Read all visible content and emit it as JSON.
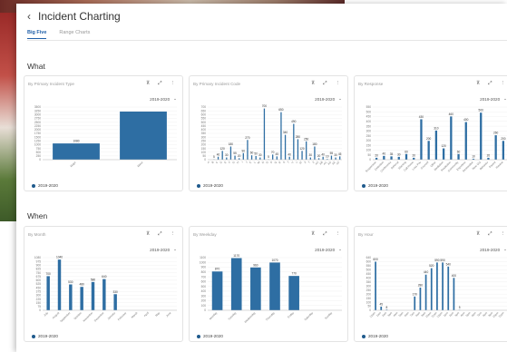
{
  "header": {
    "back_icon": "chevron-left-icon",
    "back_glyph": "‹",
    "title": "Incident Charting"
  },
  "tabs": [
    {
      "label": "Big Five",
      "active": true
    },
    {
      "label": "Range Charts",
      "active": false
    }
  ],
  "colors": {
    "bar": "#2e6ea3",
    "accent": "#1f5fa8"
  },
  "card_icons": {
    "pin": "pin-icon",
    "expand": "expand-icon",
    "menu": "more-vert-icon",
    "dropdown": "chevron-down-icon"
  },
  "sections": {
    "what": {
      "title": "What",
      "cards": [
        {
          "title": "By Primary Incident Type",
          "year": "2019-2020",
          "legend": "2019-2020",
          "chart_data": {
            "type": "bar",
            "categories": [
              "Major",
              "Minor"
            ],
            "values": [
              1080,
              3200
            ],
            "value_labels": [
              "1080",
              ""
            ],
            "yticks": [
              "3500",
              "3250",
              "3000",
              "2750",
              "2500",
              "2250",
              "2000",
              "1750",
              "1500",
              "1250",
              "1000",
              "750",
              "500",
              "250",
              "0"
            ],
            "ylim": [
              0,
              3500
            ]
          }
        },
        {
          "title": "By Primary Incident Code",
          "year": "2019-2020",
          "legend": "2019-2020",
          "chart_data": {
            "type": "bar",
            "categories": [
              "A",
              "B",
              "C",
              "D",
              "E",
              "F",
              "G",
              "H",
              "I",
              "J",
              "K",
              "L",
              "M",
              "N",
              "O",
              "P",
              "Q",
              "R",
              "S",
              "T",
              "U",
              "V",
              "W",
              "X",
              "Y",
              "Z",
              "AA",
              "AB",
              "AC",
              "AD",
              "AE",
              "AF"
            ],
            "values": [
              0,
              5,
              40,
              120,
              30,
              180,
              55,
              20,
              90,
              270,
              60,
              50,
              30,
              700,
              5,
              70,
              45,
              650,
              340,
              40,
              490,
              280,
              120,
              250,
              30,
              180,
              20,
              40,
              10,
              55,
              30,
              45
            ],
            "yticks": [
              "700",
              "650",
              "600",
              "550",
              "500",
              "450",
              "400",
              "350",
              "300",
              "250",
              "200",
              "150",
              "100",
              "50",
              "0"
            ],
            "ylim": [
              0,
              720
            ]
          }
        },
        {
          "title": "By Response",
          "year": "2019-2020",
          "legend": "2019-2020",
          "chart_data": {
            "type": "bar",
            "categories": [
              "Suspension",
              "Detention",
              "Conference",
              "Referral",
              "Warning",
              "Call Home",
              "Loss Priv",
              "Counsel",
              "Other",
              "Mediation",
              "Restitution",
              "Community",
              "Expulsion",
              "Restorative",
              "Time Out",
              "Behavior",
              "Parent",
              "Review"
            ],
            "values": [
              20,
              40,
              35,
              30,
              60,
              20,
              430,
              200,
              310,
              120,
              460,
              60,
              400,
              10,
              500,
              20,
              260,
              200
            ],
            "yticks": [
              "550",
              "500",
              "450",
              "400",
              "350",
              "300",
              "250",
              "200",
              "150",
              "100",
              "50",
              "0"
            ],
            "ylim": [
              0,
              560
            ]
          }
        }
      ]
    },
    "when": {
      "title": "When",
      "cards": [
        {
          "title": "By Month",
          "year": "2019-2020",
          "legend": "2019-2020",
          "chart_data": {
            "type": "bar",
            "categories": [
              "July",
              "August",
              "September",
              "October",
              "November",
              "December",
              "January",
              "February",
              "March",
              "April",
              "May",
              "June"
            ],
            "values": [
              700,
              1040,
              530,
              480,
              580,
              640,
              330,
              0,
              0,
              0,
              0,
              0
            ],
            "value_labels": [
              "700",
              "1040",
              "530",
              "480",
              "580",
              "640",
              "330",
              "",
              "",
              "",
              "",
              ""
            ],
            "yticks": [
              "1080",
              "975",
              "900",
              "825",
              "750",
              "675",
              "600",
              "525",
              "450",
              "375",
              "300",
              "225",
              "150",
              "75",
              "0"
            ],
            "ylim": [
              0,
              1080
            ]
          }
        },
        {
          "title": "By Weekday",
          "year": "2019-2020",
          "legend": "2019-2020",
          "chart_data": {
            "type": "bar",
            "categories": [
              "Monday",
              "Tuesday",
              "Wednesday",
              "Thursday",
              "Friday",
              "Saturday",
              "Sunday"
            ],
            "values": [
              870,
              1170,
              960,
              1070,
              770,
              0,
              0
            ],
            "value_labels": [
              "870",
              "1170",
              "960",
              "1070",
              "770",
              "",
              ""
            ],
            "yticks": [
              "1100",
              "1000",
              "900",
              "800",
              "700",
              "600",
              "500",
              "400",
              "300",
              "200",
              "100",
              "0"
            ],
            "ylim": [
              0,
              1180
            ]
          }
        },
        {
          "title": "By Hour",
          "year": "2019-2020",
          "legend": "2019-2020",
          "chart_data": {
            "type": "bar",
            "categories": [
              "12am",
              "1am",
              "2am",
              "3am",
              "4am",
              "5am",
              "6am",
              "7am",
              "8am",
              "9am",
              "10am",
              "11am",
              "12pm",
              "1pm",
              "2pm",
              "3pm",
              "4pm",
              "5pm",
              "6pm",
              "7pm",
              "8pm",
              "9pm",
              "10pm",
              "11pm"
            ],
            "values": [
              600,
              45,
              8,
              0,
              0,
              0,
              0,
              170,
              280,
              440,
              520,
              590,
              590,
              540,
              400,
              5,
              0,
              0,
              0,
              0,
              0,
              0,
              0,
              0
            ],
            "yticks": [
              "640",
              "600",
              "550",
              "500",
              "450",
              "400",
              "350",
              "300",
              "250",
              "200",
              "150",
              "100",
              "50",
              "0"
            ],
            "ylim": [
              0,
              650
            ]
          }
        }
      ]
    }
  }
}
